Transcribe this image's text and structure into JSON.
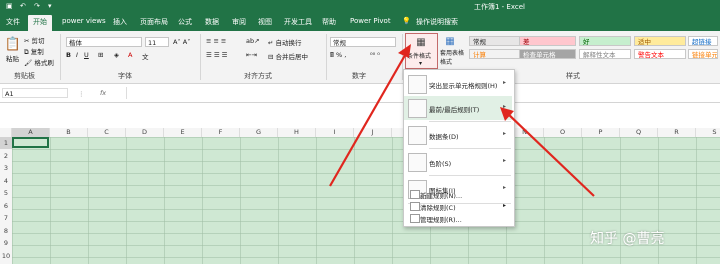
{
  "title_bar": {
    "doc_title": "工作簿1 - Excel"
  },
  "tabs": [
    "文件",
    "开始",
    "power views",
    "插入",
    "页面布局",
    "公式",
    "数据",
    "审阅",
    "视图",
    "开发工具",
    "帮助",
    "Power Pivot",
    "操作说明搜索"
  ],
  "clipboard": {
    "paste": "粘贴",
    "cut": "剪切",
    "copy": "复制",
    "format_painter": "格式刷",
    "group": "剪贴板"
  },
  "font": {
    "name": "楷体",
    "size": "11",
    "group": "字体"
  },
  "alignment": {
    "wrap": "自动换行",
    "merge": "合并后居中",
    "group": "对齐方式"
  },
  "number": {
    "format": "常规",
    "group": "数字"
  },
  "styles": {
    "conditional_format": "条件格式",
    "format_table": "套用表格格式",
    "group": "样式",
    "cells": [
      {
        "label": "常规",
        "bg": "#e7e6e6",
        "fg": "#222222"
      },
      {
        "label": "差",
        "bg": "#ffc7ce",
        "fg": "#9c0006"
      },
      {
        "label": "好",
        "bg": "#c6efce",
        "fg": "#006100"
      },
      {
        "label": "适中",
        "bg": "#ffeb9c",
        "fg": "#9c5700"
      },
      {
        "label": "超链接",
        "bg": "#ffffff",
        "fg": "#0563c1"
      },
      {
        "label": "计算",
        "bg": "#f2f2f2",
        "fg": "#fa7d00"
      },
      {
        "label": "检查单元格",
        "bg": "#a5a5a5",
        "fg": "#ffffff"
      },
      {
        "label": "解释性文本",
        "bg": "#ffffff",
        "fg": "#7f7f7f"
      },
      {
        "label": "警告文本",
        "bg": "#ffffff",
        "fg": "#ff0000"
      },
      {
        "label": "链接单元格",
        "bg": "#ffffff",
        "fg": "#fa7d00"
      }
    ]
  },
  "formula_bar": {
    "name_box": "A1",
    "fx": "fx"
  },
  "columns": [
    "A",
    "B",
    "C",
    "D",
    "E",
    "F",
    "G",
    "H",
    "I",
    "J",
    "K",
    "L",
    "M",
    "N",
    "O",
    "P",
    "Q",
    "R",
    "S"
  ],
  "rows": [
    "1",
    "2",
    "3",
    "4",
    "5",
    "6",
    "7",
    "8",
    "9",
    "10"
  ],
  "menu": {
    "items": [
      {
        "label": "突出显示单元格规则(H)",
        "icon": "highlight-rules-icon"
      },
      {
        "label": "最前/最后规则(T)",
        "icon": "top-bottom-icon"
      },
      {
        "label": "数据条(D)",
        "icon": "data-bars-icon"
      },
      {
        "label": "色阶(S)",
        "icon": "color-scales-icon"
      },
      {
        "label": "图标集(I)",
        "icon": "icon-sets-icon"
      }
    ],
    "small_items": [
      "新建规则(N)...",
      "清除规则(C)",
      "管理规则(R)..."
    ]
  },
  "watermark": "知乎 @曹亮",
  "arrow_color": "#e0261e"
}
